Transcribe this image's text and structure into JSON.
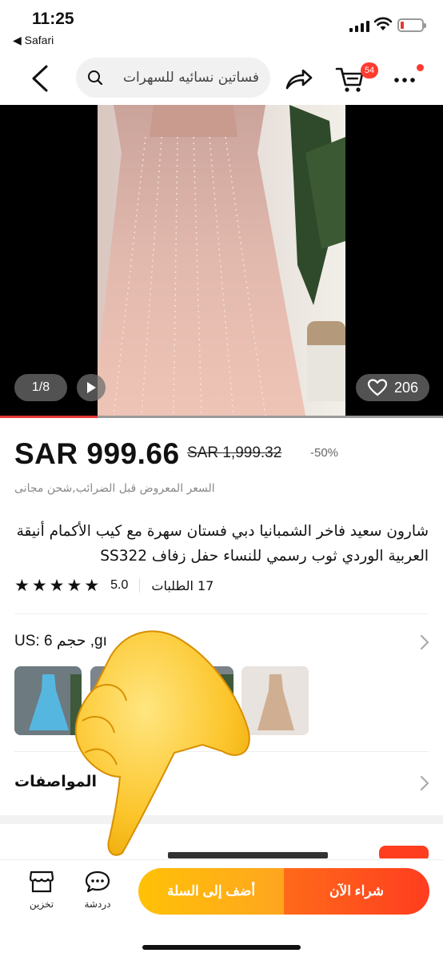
{
  "status_bar": {
    "time": "11:25",
    "back_app": "◀ Safari"
  },
  "nav": {
    "search_placeholder": "فساتين نسائيه للسهرات",
    "cart_badge": "54"
  },
  "gallery": {
    "counter": "1/8",
    "likes": "206",
    "progress": 0.22
  },
  "price": {
    "current": "SAR 999.66",
    "original": "SAR 1,999.32",
    "discount": "-50%",
    "note": "السعر المعروض قبل الضرائب,شحن مجانى"
  },
  "product": {
    "title": "شارون سعيد فاخر الشمبانيا دبي فستان سهرة مع كيب الأكمام أنيقة العربية الوردي ثوب رسمي للنساء حفل زفاف SS322",
    "rating": "5.0",
    "stars": 5,
    "orders": "17 الطلبات"
  },
  "variant": {
    "text": "US: 6 حجم ,gı"
  },
  "specs": {
    "label": "المواصفات"
  },
  "bottom_bar": {
    "store_label": "تخزين",
    "chat_label": "دردشة",
    "add_to_cart": "أضف إلى السلة",
    "buy_now": "شراء الآن"
  },
  "colors": {
    "accent_red": "#ff3d1f",
    "accent_yellow": "#ffc107"
  }
}
